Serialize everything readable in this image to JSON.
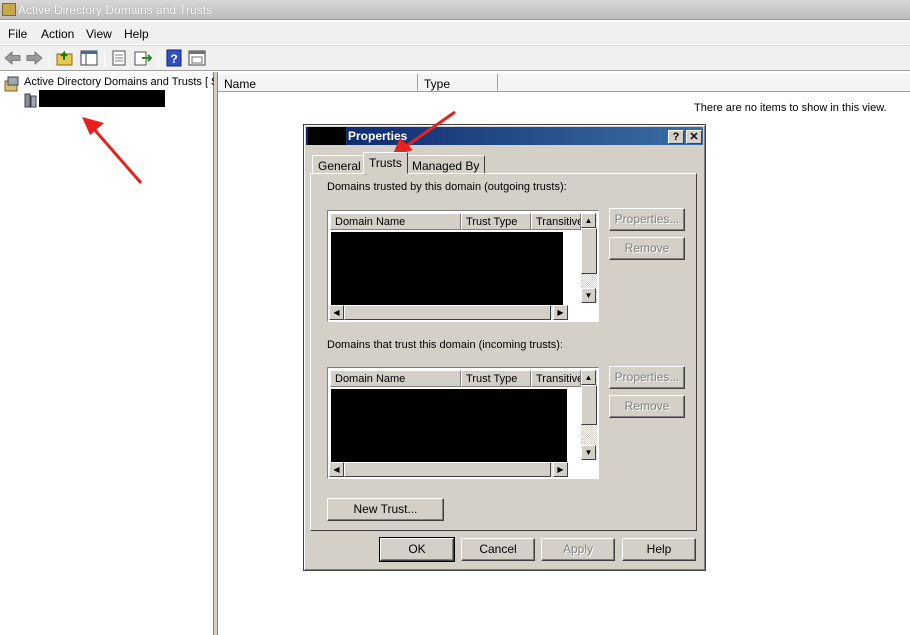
{
  "window": {
    "title": "Active Directory Domains and Trusts"
  },
  "menu": [
    "File",
    "Action",
    "View",
    "Help"
  ],
  "toolbar": {
    "icons": [
      "back-arrow-icon",
      "forward-arrow-icon",
      "up-folder-icon",
      "show-hide-tree-icon",
      "properties-icon",
      "export-list-icon",
      "help-icon",
      "console-icon"
    ]
  },
  "tree": {
    "root_label": "Active Directory Domains and Trusts [ S"
  },
  "list": {
    "columns": [
      "Name",
      "Type"
    ],
    "empty_message": "There are no items to show in this view."
  },
  "dialog": {
    "title": "Properties",
    "help_button": "?",
    "close_button": "✕",
    "tabs": [
      "General",
      "Trusts",
      "Managed By"
    ],
    "active_tab": "Trusts",
    "outgoing_label": "Domains trusted by this domain (outgoing trusts):",
    "incoming_label": "Domains that trust this domain (incoming trusts):",
    "list_columns": [
      "Domain Name",
      "Trust Type",
      "Transitive"
    ],
    "side_buttons": {
      "properties": "Properties...",
      "remove": "Remove"
    },
    "new_trust": "New Trust...",
    "footer": {
      "ok": "OK",
      "cancel": "Cancel",
      "apply": "Apply",
      "help": "Help"
    }
  },
  "colors": {
    "dialog_title_start": "#0a246a",
    "dialog_title_end": "#3a6ea5",
    "annotation_arrow": "#e8211c"
  }
}
